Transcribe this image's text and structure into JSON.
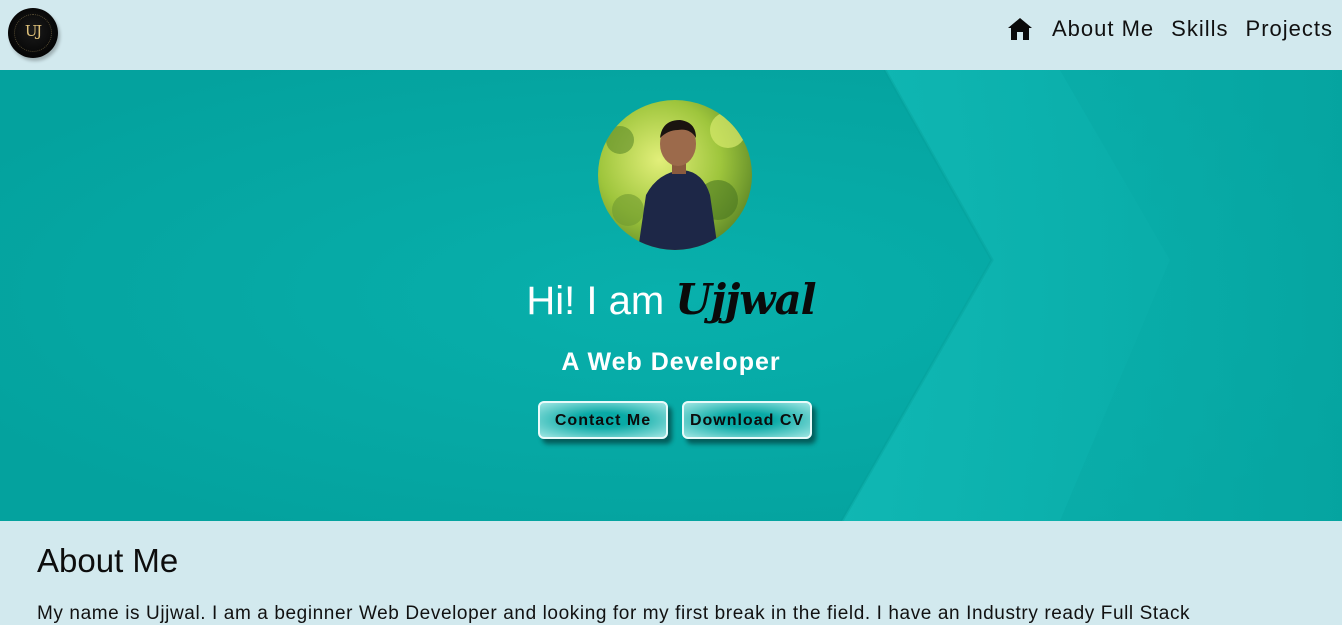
{
  "nav": {
    "logo_text": "UJ",
    "links": [
      "About Me",
      "Skills",
      "Projects"
    ]
  },
  "hero": {
    "greeting": "Hi! I am",
    "name": "Ujjwal",
    "subtitle": "A Web Developer",
    "buttons": {
      "contact": "Contact Me",
      "download": "Download CV"
    }
  },
  "about": {
    "heading": "About Me",
    "text": "My name is Ujjwal. I am a beginner Web Developer and looking for my first break in the field. I have an Industry ready Full Stack"
  },
  "colors": {
    "nav_bg": "#d2e9ee",
    "hero_bg": "#06a7a3",
    "hero_text": "#ffffff"
  }
}
